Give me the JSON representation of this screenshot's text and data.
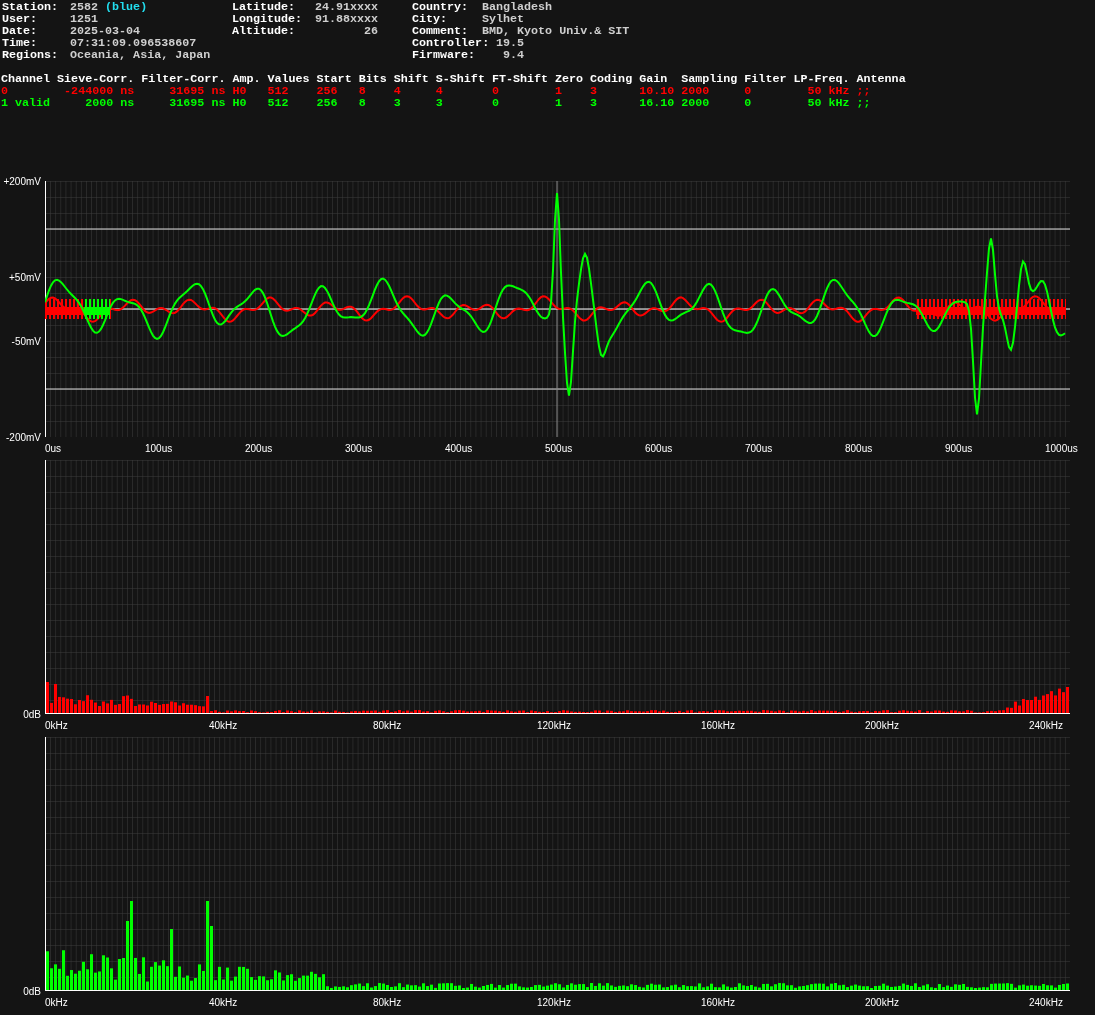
{
  "info_columns": [
    [
      {
        "label": "Station:",
        "value": "2582",
        "tag": "(blue)"
      },
      {
        "label": "User:",
        "value": "1251"
      },
      {
        "label": "Date:",
        "value": "2025-03-04"
      },
      {
        "label": "Time:",
        "value": "07:31:09.096538607"
      },
      {
        "label": "Regions:",
        "value": "Oceania, Asia, Japan"
      }
    ],
    [
      {
        "label": "Latitude:",
        "value": "24.91xxxx"
      },
      {
        "label": "Longitude:",
        "value": "91.88xxxx"
      },
      {
        "label": "Altitude:",
        "value": "26"
      }
    ],
    [
      {
        "label": "Country:",
        "value": "Bangladesh"
      },
      {
        "label": "City:",
        "value": "Sylhet"
      },
      {
        "label": "Comment:",
        "value": "BMD, Kyoto Univ.& SIT"
      },
      {
        "label": "Controller:",
        "value": "19.5"
      },
      {
        "label": "Firmware:",
        "value": "9.4"
      }
    ]
  ],
  "channel_table": {
    "columns": [
      "Channel",
      "Sieve-Corr.",
      "Filter-Corr.",
      "Amp.",
      "Values",
      "Start",
      "Bits",
      "Shift",
      "S-Shift",
      "FT-Shift",
      "Zero",
      "Coding",
      "Gain",
      "Sampling",
      "Filter",
      "LP-Freq.",
      "Antenna"
    ],
    "rows": [
      {
        "color": "#ff0000",
        "cells": [
          "0",
          "-244000 ns",
          "31695 ns",
          "H0",
          "512",
          "256",
          "8",
          "4",
          "4",
          "0",
          "1",
          "3",
          "10.10",
          "2000",
          "0",
          "50 kHz",
          ";;"
        ]
      },
      {
        "color": "#00ff00",
        "cells": [
          "1 valid",
          "2000 ns",
          "31695 ns",
          "H0",
          "512",
          "256",
          "8",
          "3",
          "3",
          "0",
          "1",
          "3",
          "16.10",
          "2000",
          "0",
          "50 kHz",
          ";;"
        ]
      }
    ]
  },
  "waveform": {
    "y_labels": [
      "+200mV",
      "+50mV",
      "-50mV",
      "-200mV"
    ],
    "x_labels": [
      "0us",
      "100us",
      "200us",
      "300us",
      "400us",
      "500us",
      "600us",
      "700us",
      "800us",
      "900us",
      "1000us"
    ],
    "traces": [
      {
        "color": "#ff0000"
      },
      {
        "color": "#00ff00"
      }
    ]
  },
  "spectra": [
    {
      "color": "#ff0000",
      "y_label": "0dB",
      "x_labels": [
        "0kHz",
        "40kHz",
        "80kHz",
        "120kHz",
        "160kHz",
        "200kHz",
        "240kHz"
      ]
    },
    {
      "color": "#00ff00",
      "y_label": "0dB",
      "x_labels": [
        "0kHz",
        "40kHz",
        "80kHz",
        "120kHz",
        "160kHz",
        "200kHz",
        "240kHz"
      ]
    }
  ]
}
